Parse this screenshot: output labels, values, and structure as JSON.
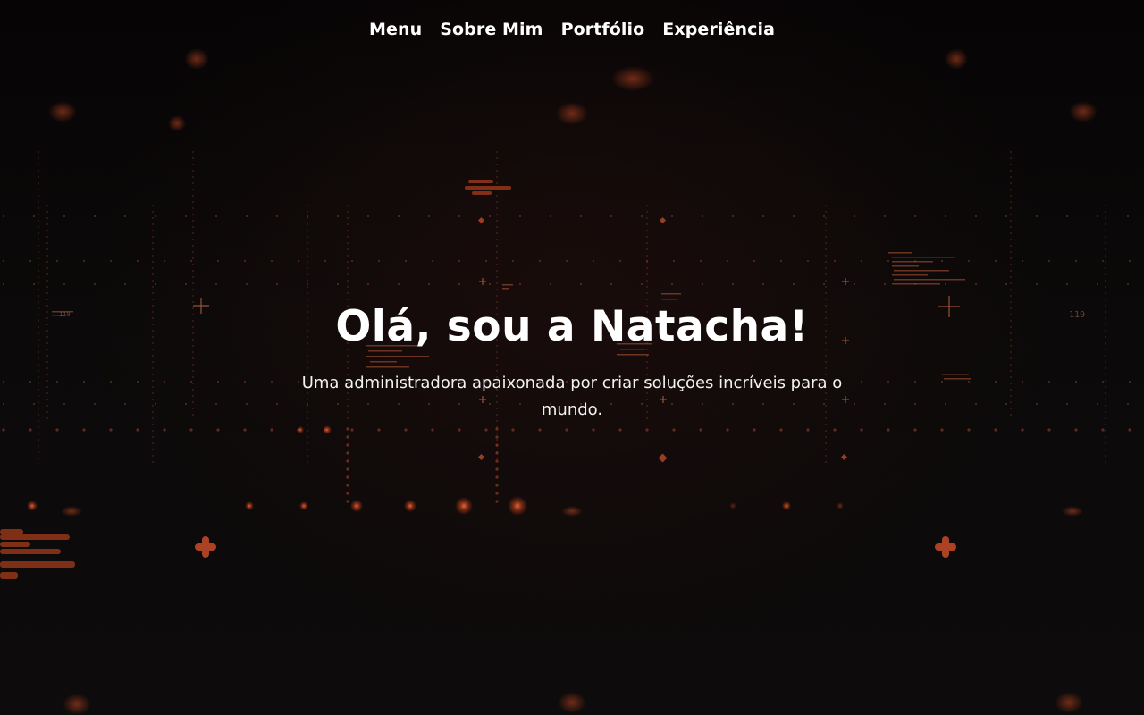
{
  "nav": {
    "items": [
      {
        "label": "Menu"
      },
      {
        "label": "Sobre Mim"
      },
      {
        "label": "Portfólio"
      },
      {
        "label": "Experiência"
      }
    ]
  },
  "hero": {
    "title": "Olá, sou a Natacha!",
    "subtitle": "Uma administradora apaixonada por criar soluções incríveis para o mundo."
  },
  "background": {
    "labels": [
      "119",
      "119"
    ]
  },
  "colors": {
    "background": "#0b0909",
    "accent": "#e0522a",
    "text": "#ffffff"
  }
}
